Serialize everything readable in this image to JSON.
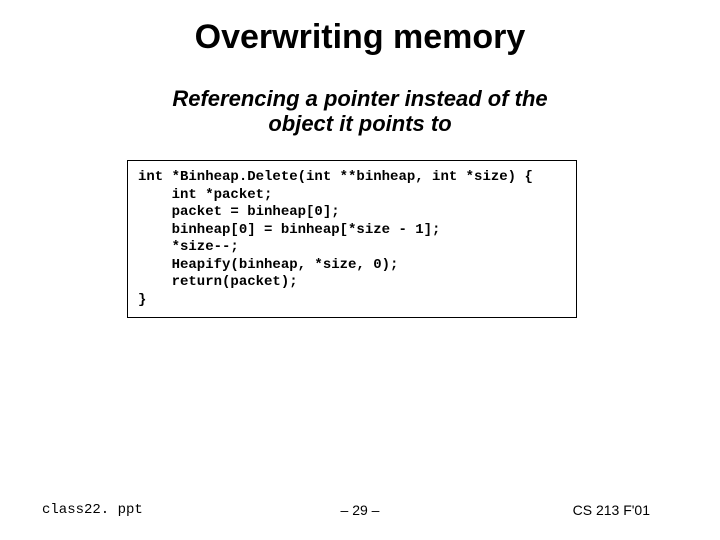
{
  "title": "Overwriting memory",
  "subtitle_line1": "Referencing a pointer instead of the",
  "subtitle_line2": "object it points to",
  "code": "int *Binheap.Delete(int **binheap, int *size) {\n    int *packet;\n    packet = binheap[0];\n    binheap[0] = binheap[*size - 1];\n    *size--;\n    Heapify(binheap, *size, 0);\n    return(packet);\n}",
  "footer": {
    "left": "class22. ppt",
    "center": "– 29 –",
    "right": "CS 213 F'01"
  }
}
